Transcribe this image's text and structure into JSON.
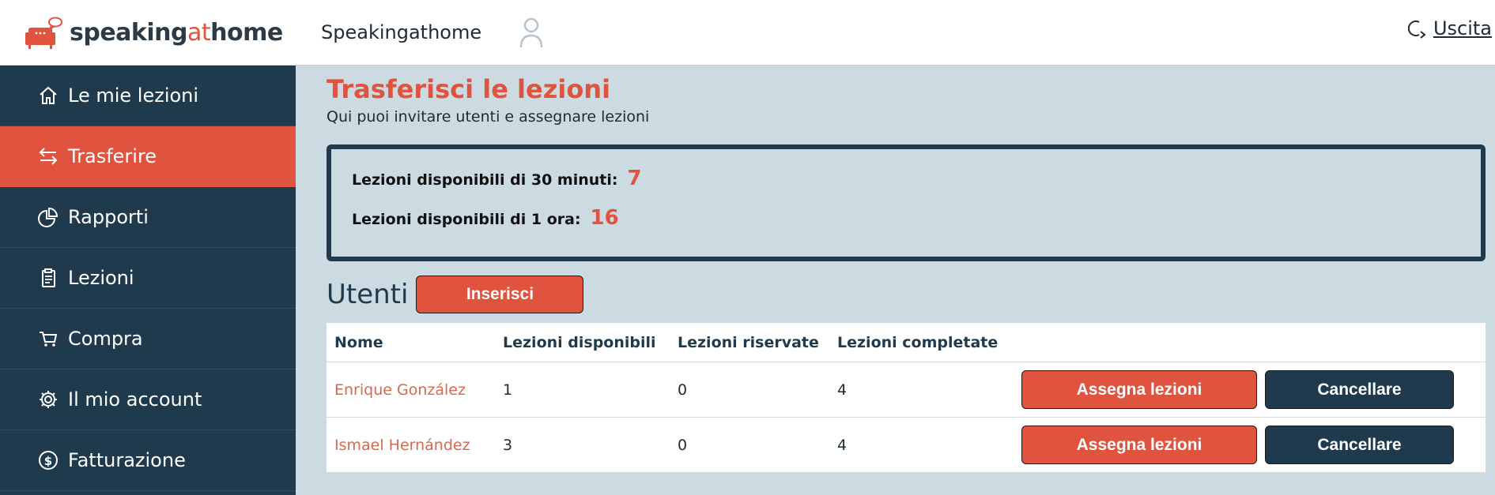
{
  "logo": {
    "text_bold_1": "speaking",
    "text_at": "at",
    "text_bold_2": "home"
  },
  "header": {
    "title": "Speakingathome",
    "logout_label": "Uscita"
  },
  "sidebar": {
    "items": [
      {
        "label": "Le mie lezioni",
        "icon": "home-icon"
      },
      {
        "label": "Trasferire",
        "icon": "transfer-icon",
        "active": true
      },
      {
        "label": "Rapporti",
        "icon": "pie-chart-icon"
      },
      {
        "label": "Lezioni",
        "icon": "document-icon"
      },
      {
        "label": "Compra",
        "icon": "cart-icon"
      },
      {
        "label": "Il mio account",
        "icon": "gear-icon"
      },
      {
        "label": "Fatturazione",
        "icon": "dollar-icon"
      }
    ]
  },
  "main": {
    "title": "Trasferisci le lezioni",
    "subtitle": "Qui puoi invitare utenti e assegnare lezioni",
    "stats": [
      {
        "label": "Lezioni disponibili di 30 minuti:",
        "value": "7"
      },
      {
        "label": "Lezioni disponibili di 1 ora:",
        "value": "16"
      }
    ],
    "users_title": "Utenti",
    "insert_label": "Inserisci",
    "table": {
      "headers": [
        "Nome",
        "Lezioni disponibili",
        "Lezioni riservate",
        "Lezioni completate"
      ],
      "rows": [
        {
          "name": "Enrique González",
          "available": "1",
          "reserved": "0",
          "completed": "4"
        },
        {
          "name": "Ismael Hernández",
          "available": "3",
          "reserved": "0",
          "completed": "4"
        }
      ],
      "assign_label": "Assegna lezioni",
      "cancel_label": "Cancellare"
    }
  },
  "colors": {
    "accent": "#e0533f",
    "dark": "#1f3a4d",
    "background": "#ccdbe2"
  }
}
